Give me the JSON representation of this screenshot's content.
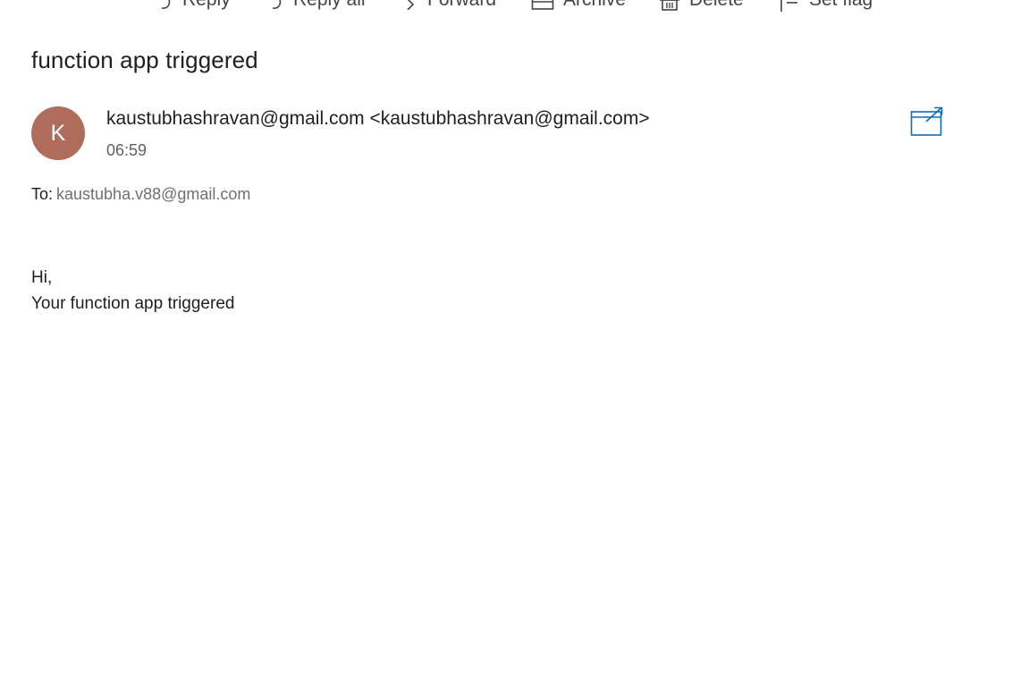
{
  "toolbar": {
    "reply_label": "Reply",
    "reply_all_label": "Reply all",
    "forward_label": "Forward",
    "archive_label": "Archive",
    "delete_label": "Delete",
    "set_flag_label": "Set flag"
  },
  "message": {
    "subject": "function app triggered",
    "avatar_initial": "K",
    "avatar_color": "#b06d5c",
    "sender": "kaustubhashravan@gmail.com <kaustubhashravan@gmail.com>",
    "time": "06:59",
    "to_label": "To:",
    "to_address": "kaustubha.v88@gmail.com",
    "body_lines": [
      "Hi,",
      "Your function app triggered"
    ]
  },
  "icons": {
    "reply": "reply-icon",
    "reply_all": "reply-all-icon",
    "forward": "forward-icon",
    "archive": "archive-icon",
    "delete": "delete-icon",
    "flag": "flag-icon",
    "popout": "open-in-new-window-icon"
  },
  "colors": {
    "accent": "#0f6cbd"
  }
}
